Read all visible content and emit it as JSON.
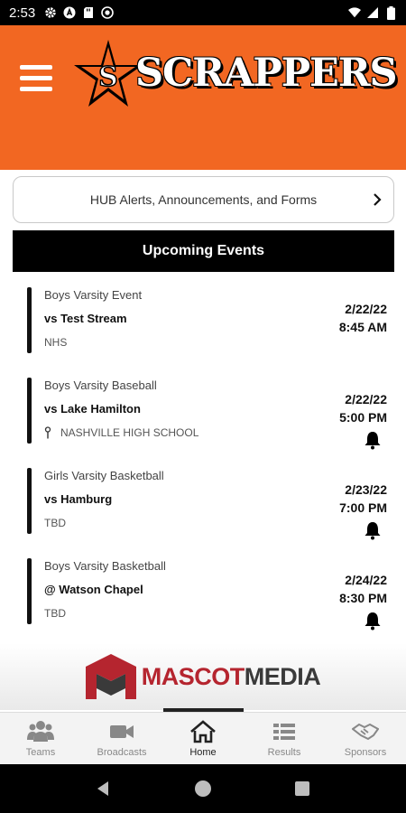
{
  "status_bar": {
    "time": "2:53"
  },
  "header": {
    "logo_text": "SCRAPPERS",
    "accent_color": "#f26722"
  },
  "hub_button": {
    "label": "HUB Alerts, Announcements, and Forms"
  },
  "events_section": {
    "title": "Upcoming Events",
    "events": [
      {
        "team": "Boys Varsity Event",
        "opponent": "vs Test Stream",
        "location": "NHS",
        "date": "2/22/22",
        "time": "8:45 AM",
        "has_bell": false,
        "has_pin": false
      },
      {
        "team": "Boys Varsity Baseball",
        "opponent": "vs Lake Hamilton",
        "location": "NASHVILLE HIGH SCHOOL",
        "date": "2/22/22",
        "time": "5:00 PM",
        "has_bell": true,
        "has_pin": true
      },
      {
        "team": "Girls Varsity Basketball",
        "opponent": "vs Hamburg",
        "location": "TBD",
        "date": "2/23/22",
        "time": "7:00 PM",
        "has_bell": true,
        "has_pin": false
      },
      {
        "team": "Boys Varsity Basketball",
        "opponent": "@ Watson Chapel",
        "location": "TBD",
        "date": "2/24/22",
        "time": "8:30 PM",
        "has_bell": true,
        "has_pin": false
      }
    ]
  },
  "sponsor": {
    "name_part1": "MASCOT",
    "name_part2": "MEDIA"
  },
  "bottom_nav": {
    "items": [
      {
        "label": "Teams",
        "icon": "teams-icon"
      },
      {
        "label": "Broadcasts",
        "icon": "video-camera-icon"
      },
      {
        "label": "Home",
        "icon": "home-icon",
        "active": true
      },
      {
        "label": "Results",
        "icon": "results-list-icon"
      },
      {
        "label": "Sponsors",
        "icon": "handshake-icon"
      }
    ]
  }
}
